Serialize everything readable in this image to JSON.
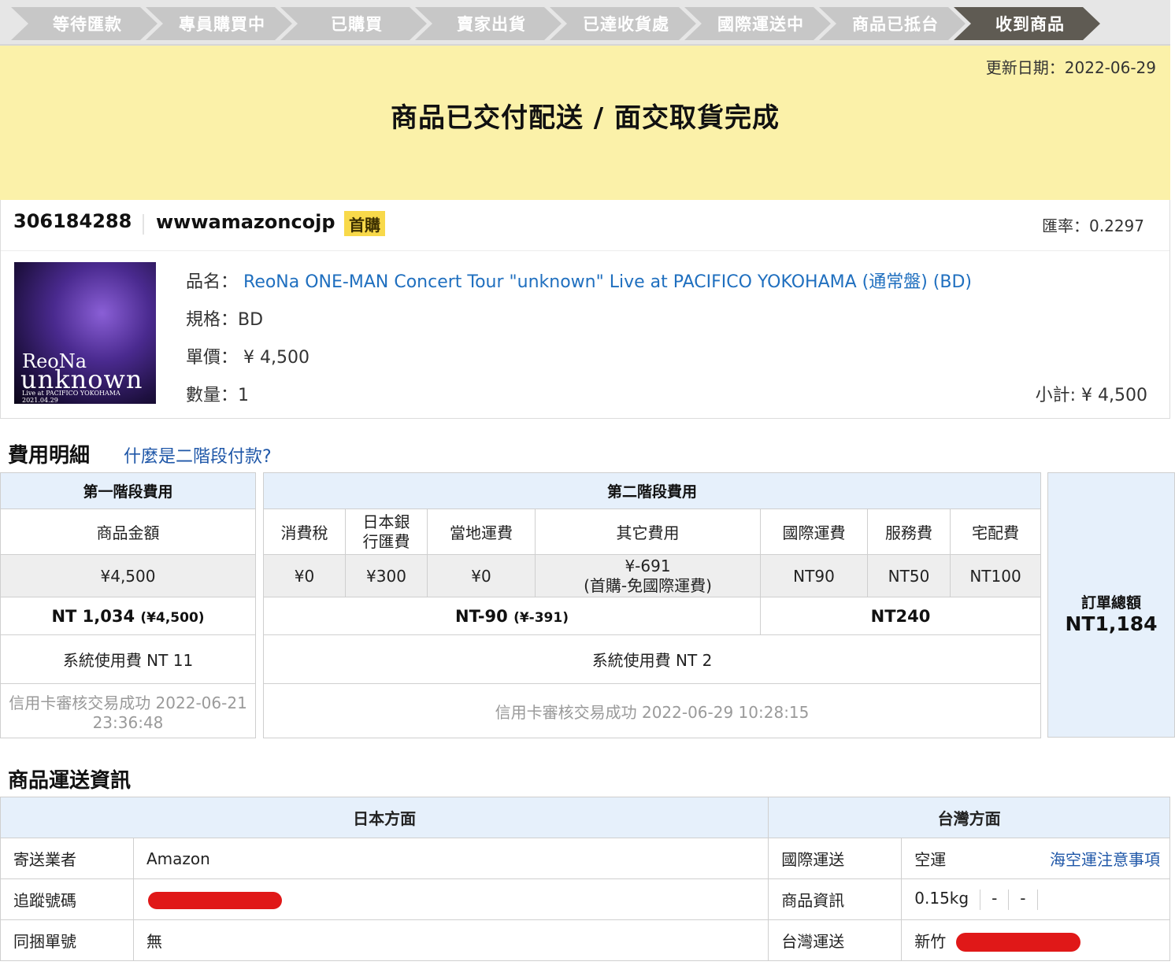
{
  "steps": [
    "等待匯款",
    "專員購買中",
    "已購買",
    "賣家出貨",
    "已達收貨處",
    "國際運送中",
    "商品已抵台",
    "收到商品"
  ],
  "active_step": 7,
  "banner": {
    "update_label": "更新日期：2022-06-29",
    "status": "商品已交付配送 / 面交取貨完成",
    "bg_color": "#fbf1a9"
  },
  "order": {
    "id": "306184288",
    "store": "wwwamazoncojp",
    "badge": "首購",
    "rate": "匯率：0.2297",
    "cover": {
      "line1": "ReoNa",
      "line2": "unknown",
      "line3": "Live at PACIFICO YOKOHAMA 2021.04.29"
    },
    "name_label": "品名：",
    "name": "ReoNa ONE-MAN Concert Tour \"unknown\" Live at PACIFICO YOKOHAMA (通常盤) (BD)",
    "spec": "規格：BD",
    "price": "單價： ¥ 4,500",
    "qty": "數量：1",
    "subtotal": "小計: ¥ 4,500"
  },
  "fees": {
    "title": "費用明細",
    "help_link": "什麼是二階段付款?",
    "stage1": {
      "header": "第一階段費用",
      "col": "商品金額",
      "value": "¥4,500",
      "total": "NT 1,034",
      "total_jp": "(¥4,500)",
      "sys_fee": "系統使用費 NT 11",
      "status_line1": "信用卡審核交易成功 2022-06-21",
      "status_line2": "23:36:48"
    },
    "stage2": {
      "header": "第二階段費用",
      "cols": [
        "消費稅",
        "日本銀",
        "行匯費",
        "當地運費",
        "其它費用",
        "國際運費",
        "服務費",
        "宅配費"
      ],
      "values": [
        "¥0",
        "¥300",
        "¥0",
        "¥-691",
        "(首購-免國際運費)",
        "NT90",
        "NT50",
        "NT100"
      ],
      "subtotal_a": "NT-90",
      "subtotal_a_jp": "(¥-391)",
      "subtotal_b": "NT240",
      "sys_fee": "系統使用費 NT 2",
      "status": "信用卡審核交易成功 2022-06-29 10:28:15"
    },
    "total_label": "訂單總額",
    "total_value": "NT1,184"
  },
  "shipping": {
    "title": "商品運送資訊",
    "jp_header": "日本方面",
    "tw_header": "台灣方面",
    "rows": [
      {
        "jp_label": "寄送業者",
        "jp_value": "Amazon",
        "tw_label": "國際運送",
        "tw_value": "空運"
      },
      {
        "jp_label": "追蹤號碼",
        "jp_value": "",
        "tw_label": "商品資訊",
        "tw_value": "0.15kg"
      },
      {
        "jp_label": "同捆單號",
        "jp_value": "無",
        "tw_label": "台灣運送",
        "tw_value": "新竹"
      }
    ],
    "notice_link": "海空運注意事項",
    "dash": "-"
  },
  "colors": {
    "accent_step": "#5f5b53",
    "table_head": "#e6f0fb",
    "link": "#1f57a8",
    "redaction": "#e01818"
  }
}
